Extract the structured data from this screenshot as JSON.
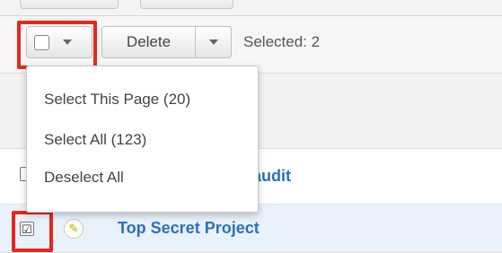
{
  "toolbar": {
    "delete_label": "Delete",
    "selected_text": "Selected: 2"
  },
  "mass_select_menu": {
    "items": [
      {
        "label": "Select This Page (20)"
      },
      {
        "label": "Select All (123)"
      },
      {
        "label": "Deselect All"
      }
    ]
  },
  "records": [
    {
      "name": "an for the annual audit",
      "checked": false
    },
    {
      "name": "Top Secret Project",
      "checked": true
    }
  ],
  "icons": {
    "checked_glyph": "☑",
    "pencil_glyph": "✎"
  },
  "colors": {
    "highlight": "#e8271c",
    "link": "#2b6fc0",
    "selected_row_bg": "#e9f1fa",
    "toolbar_bg": "#f6f6f6"
  }
}
